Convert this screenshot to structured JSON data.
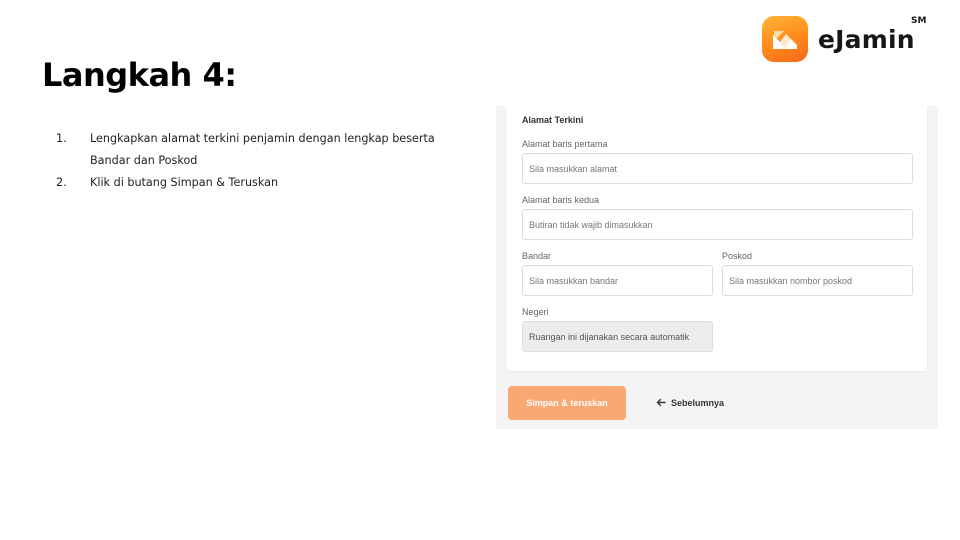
{
  "brand": {
    "name": "eJamin",
    "mark": "SM",
    "logo_icon": "mountain-icon"
  },
  "slide": {
    "title": "Langkah 4:",
    "steps": [
      {
        "num": "1.",
        "text": "Lengkapkan alamat terkini penjamin dengan lengkap beserta Bandar dan Poskod"
      },
      {
        "num": "2.",
        "text": "Klik di butang Simpan & Teruskan"
      }
    ]
  },
  "form": {
    "section_title": "Alamat Terkini",
    "address1": {
      "label": "Alamat baris pertama",
      "placeholder": "Sila masukkan alamat"
    },
    "address2": {
      "label": "Alamat baris kedua",
      "placeholder": "Butiran tidak wajib dimasukkan"
    },
    "city": {
      "label": "Bandar",
      "placeholder": "Sila masukkan bandar"
    },
    "postcode": {
      "label": "Poskod",
      "placeholder": "Sila masukkan nombor poskod"
    },
    "state": {
      "label": "Negeri",
      "placeholder": "Ruangan ini dijanakan secara automatik"
    }
  },
  "actions": {
    "save_label": "Simpan & teruskan",
    "back_label": "Sebelumnya",
    "back_icon": "arrow-left-icon"
  },
  "colors": {
    "brand_orange": "#f4661b",
    "save_button": "#f9a872",
    "panel_bg": "#f4f4f4"
  }
}
